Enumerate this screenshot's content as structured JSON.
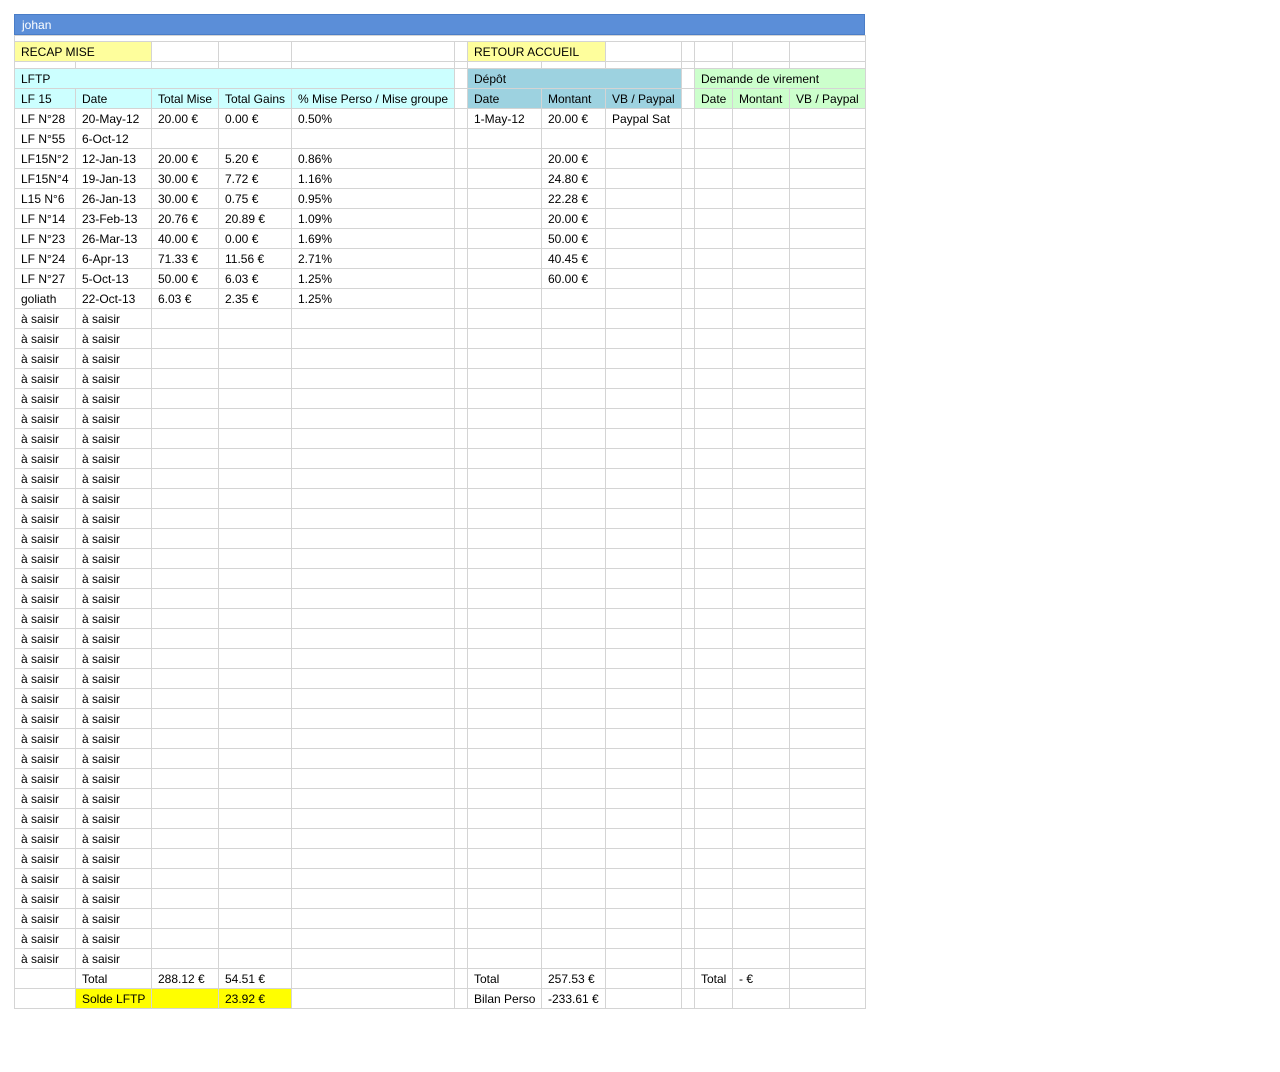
{
  "sheet": {
    "title": "johan",
    "recap_button": "RECAP MISE",
    "home_button": "RETOUR ACCUEIL",
    "colors": {
      "title_bar": "#5b8ed8",
      "button_bg": "#fefe9c",
      "lftp_header": "#ccffff",
      "depot_header": "#9dd2e0",
      "virement_header": "#ccffcc",
      "solde_highlight": "#fffe00"
    }
  },
  "lftp": {
    "title": "LFTP",
    "headers": [
      "LF 15",
      "Date",
      "Total Mise",
      "Total Gains",
      "% Mise Perso / Mise groupe"
    ],
    "rows": [
      [
        "LF N°28",
        "20-May-12",
        "20.00 €",
        "0.00 €",
        "0.50%"
      ],
      [
        "LF N°55",
        "6-Oct-12",
        "",
        "",
        ""
      ],
      [
        "LF15N°2",
        "12-Jan-13",
        "20.00 €",
        "5.20 €",
        "0.86%"
      ],
      [
        "LF15N°4",
        "19-Jan-13",
        "30.00 €",
        "7.72 €",
        "1.16%"
      ],
      [
        "L15 N°6",
        "26-Jan-13",
        "30.00 €",
        "0.75 €",
        "0.95%"
      ],
      [
        "LF N°14",
        "23-Feb-13",
        "20.76 €",
        "20.89 €",
        "1.09%"
      ],
      [
        "LF N°23",
        "26-Mar-13",
        "40.00 €",
        "0.00 €",
        "1.69%"
      ],
      [
        "LF N°24",
        "6-Apr-13",
        "71.33 €",
        "11.56 €",
        "2.71%"
      ],
      [
        "LF N°27",
        "5-Oct-13",
        "50.00 €",
        "6.03 €",
        "1.25%"
      ],
      [
        "goliath",
        "22-Oct-13",
        "6.03 €",
        "2.35 €",
        "1.25%"
      ]
    ],
    "placeholder": "à saisir",
    "placeholder_rows": 33,
    "total_label": "Total",
    "total_mise": "288.12 €",
    "total_gains": "54.51 €",
    "solde_label": "Solde LFTP",
    "solde_value": "23.92 €"
  },
  "depot": {
    "title": "Dépôt",
    "headers": [
      "Date",
      "Montant",
      "VB / Paypal"
    ],
    "rows": [
      [
        "1-May-12",
        "20.00 €",
        "Paypal Sat"
      ],
      [
        "",
        "",
        ""
      ],
      [
        "",
        "20.00 €",
        ""
      ],
      [
        "",
        "24.80 €",
        ""
      ],
      [
        "",
        "22.28 €",
        ""
      ],
      [
        "",
        "20.00 €",
        ""
      ],
      [
        "",
        "50.00 €",
        ""
      ],
      [
        "",
        "40.45 €",
        ""
      ],
      [
        "",
        "60.00 €",
        ""
      ]
    ],
    "total_label": "Total",
    "total_value": "257.53 €",
    "bilan_label": "Bilan Perso",
    "bilan_value": "-233.61 €"
  },
  "virement": {
    "title": "Demande de virement",
    "headers": [
      "Date",
      "Montant",
      "VB / Paypal"
    ],
    "total_label": "Total",
    "total_value": "- €"
  }
}
